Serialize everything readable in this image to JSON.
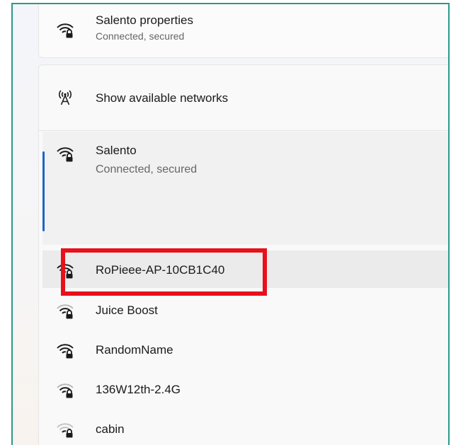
{
  "top_item": {
    "name": "Salento properties",
    "status": "Connected, secured",
    "icon": "wifi-secured-icon"
  },
  "show_networks": {
    "label": "Show available networks",
    "icon": "antenna-icon"
  },
  "connected_network": {
    "name": "Salento",
    "status": "Connected, secured",
    "icon": "wifi-secured-icon",
    "accent": "#1d64c8"
  },
  "networks": [
    {
      "name": "RoPieee-AP-10CB1C40",
      "icon": "wifi-secured-icon",
      "signal": 4
    },
    {
      "name": "Juice Boost",
      "icon": "wifi-secured-icon",
      "signal": 3
    },
    {
      "name": "RandomName",
      "icon": "wifi-secured-icon",
      "signal": 4
    },
    {
      "name": "136W12th-2.4G",
      "icon": "wifi-secured-icon",
      "signal": 3
    },
    {
      "name": "cabin",
      "icon": "wifi-secured-icon",
      "signal": 2
    }
  ],
  "highlight_color": "#e8101b"
}
